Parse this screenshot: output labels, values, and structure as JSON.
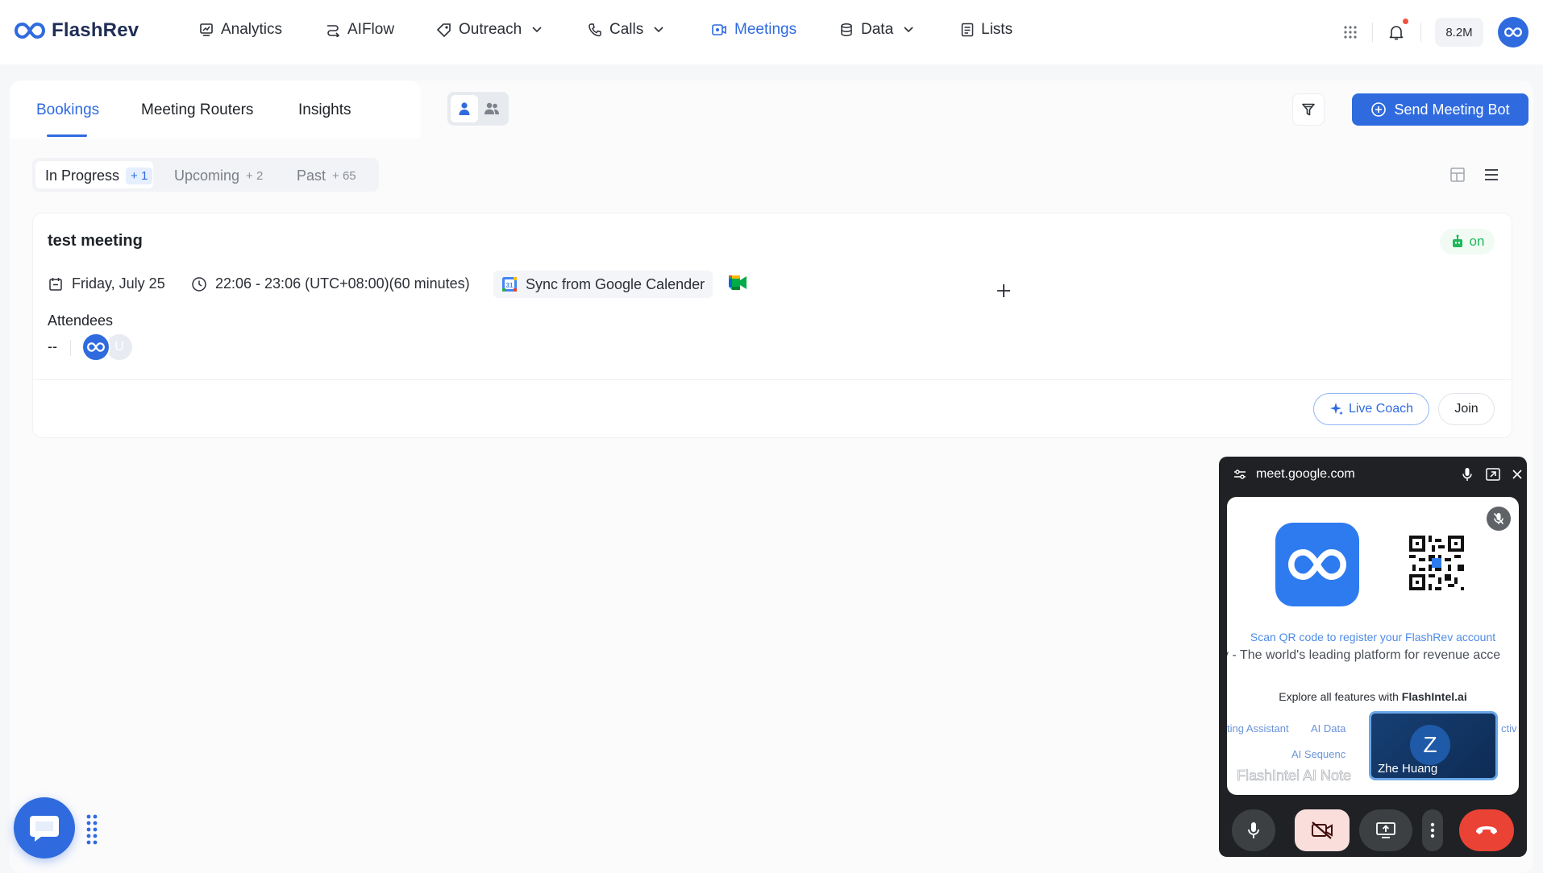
{
  "app": {
    "name": "FlashRev"
  },
  "nav": {
    "items": [
      {
        "label": "Analytics",
        "icon": "chart-icon"
      },
      {
        "label": "AIFlow",
        "icon": "flow-icon"
      },
      {
        "label": "Outreach",
        "icon": "outreach-icon",
        "has_dropdown": true
      },
      {
        "label": "Calls",
        "icon": "phone-icon",
        "has_dropdown": true
      },
      {
        "label": "Meetings",
        "icon": "video-icon",
        "active": true
      },
      {
        "label": "Data",
        "icon": "database-icon",
        "has_dropdown": true
      },
      {
        "label": "Lists",
        "icon": "list-icon"
      }
    ],
    "credits": "8.2M"
  },
  "tabs": [
    {
      "label": "Bookings",
      "active": true
    },
    {
      "label": "Meeting Routers"
    },
    {
      "label": "Insights"
    }
  ],
  "actions": {
    "send_bot_label": "Send Meeting Bot"
  },
  "subtabs": [
    {
      "label": "In Progress",
      "count": "+ 1",
      "active": true
    },
    {
      "label": "Upcoming",
      "count": "+ 2"
    },
    {
      "label": "Past",
      "count": "+ 65"
    }
  ],
  "meeting": {
    "title": "test meeting",
    "status": "on",
    "date": "Friday, July 25",
    "time": "22:06 - 23:06 (UTC+08:00)(60 minutes)",
    "sync_label": "Sync from Google Calender",
    "attendees_label": "Attendees",
    "attendees_value": "--",
    "attendee_initial": "U",
    "live_coach_label": "Live Coach",
    "join_label": "Join"
  },
  "pip": {
    "url": "meet.google.com",
    "scan_text": "Scan QR code to register your FlashRev account",
    "tagline": "v - The world's leading platform for revenue acce",
    "explore_prefix": "Explore all features with ",
    "explore_brand": "FlashIntel.ai",
    "features": [
      "ting Assistant",
      "AI Data",
      "ctiv",
      "AI Sequenc"
    ],
    "notes_text": "FlashIntel AI Note",
    "participant_initial": "Z",
    "participant_name": "Zhe Huang"
  },
  "colors": {
    "accent": "#2f6bdf",
    "status_on": "#1fb85a",
    "end_call": "#ea4335"
  }
}
